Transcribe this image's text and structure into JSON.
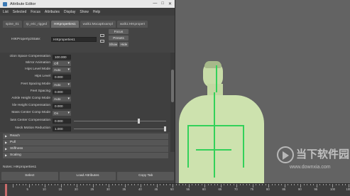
{
  "window": {
    "title": "Attribute Editor",
    "controls": [
      "—",
      "□",
      "✕"
    ]
  },
  "menu": [
    "List",
    "Selected",
    "Focus",
    "Attributes",
    "Display",
    "Show",
    "Help"
  ],
  "tabs": [
    "spine_01",
    "rp_eric_rigged",
    "HIKproperties1",
    "walk1:MocapExampl",
    "walk1:HIKpropert"
  ],
  "node": {
    "label": "HIKProperty2State:",
    "value": "HIKproperties1",
    "focus_label": "Focus",
    "presets_label": "Presets",
    "show_label": "Show",
    "hide_label": "Hide"
  },
  "attributes": [
    {
      "label": "ction Space Compensation",
      "value": "100.000",
      "kind": "field"
    },
    {
      "label": "Mirror Animation",
      "value": "Off",
      "kind": "dropdown"
    },
    {
      "label": "Hips Level Mode",
      "value": "Auto",
      "kind": "dropdown"
    },
    {
      "label": "Hips Level",
      "value": "0.000",
      "kind": "field"
    },
    {
      "label": "Feet Spacing Mode",
      "value": "Auto",
      "kind": "dropdown"
    },
    {
      "label": "Feet Spacing",
      "value": "0.000",
      "kind": "field"
    },
    {
      "label": "Ankle Height Comp Mode",
      "value": "Auto",
      "kind": "dropdown"
    },
    {
      "label": "kle Height Compensation",
      "value": "0.000",
      "kind": "field"
    },
    {
      "label": "Mass Center Comp Mode",
      "value": "On",
      "kind": "dropdown"
    },
    {
      "label": "lass Center Compensation",
      "value": "0.000",
      "kind": "slider",
      "fraction": 0.0
    },
    {
      "label": "Neck Motion Reduction",
      "value": "1.000",
      "kind": "slider",
      "fraction": 1.0
    }
  ],
  "sections": [
    "Reach",
    "Pull",
    "Stiffness",
    "Scaling"
  ],
  "notes": "Notes:  HIKproperties1",
  "buttons": {
    "select": "Select",
    "load": "Load Attributes",
    "copy": "Copy Tab"
  },
  "timeline": {
    "labels": [
      "5",
      "10",
      "15",
      "20",
      "25",
      "30",
      "35",
      "40",
      "45",
      "50",
      "55",
      "60",
      "65",
      "70",
      "75",
      "80",
      "85",
      "90",
      "95",
      "100",
      "105"
    ],
    "current": "1"
  },
  "watermark": {
    "title": "当下软件园",
    "url": "www.downxia.com"
  },
  "colors": {
    "panel": "#444444",
    "viewport": "#636363",
    "skeleton": "#33d15a",
    "mesh": "#cfe3b0"
  }
}
